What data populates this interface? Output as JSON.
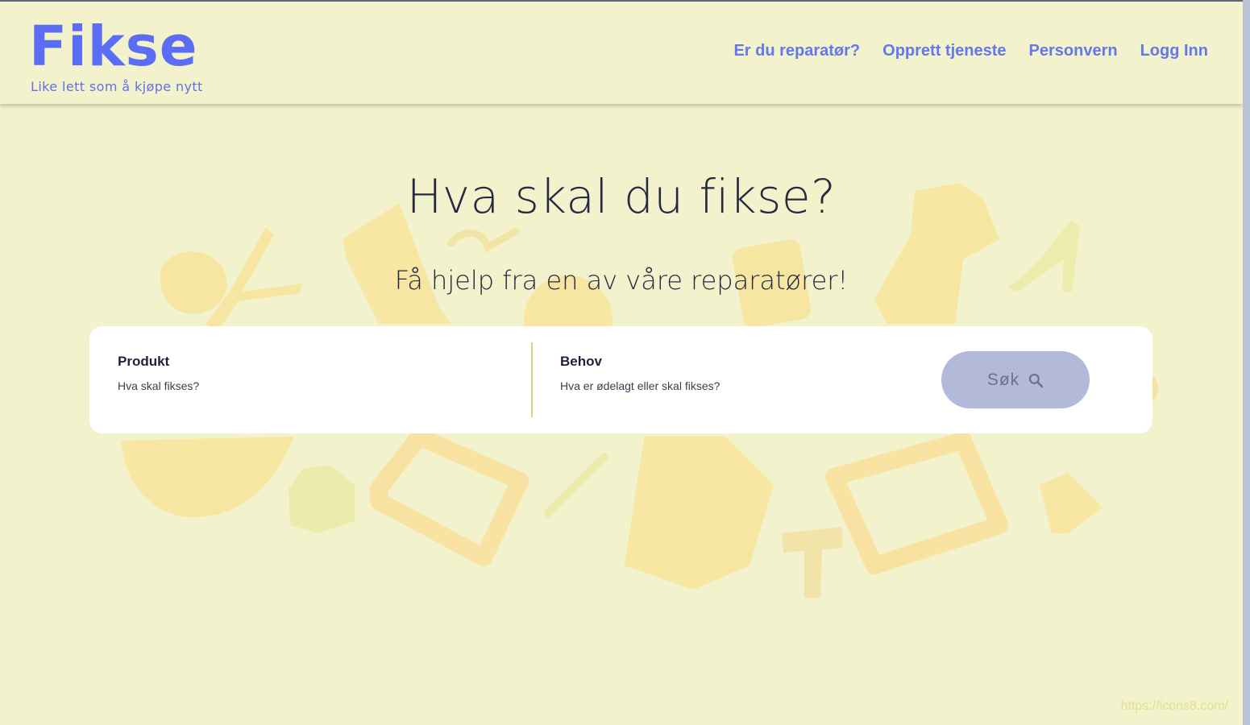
{
  "header": {
    "logo": "Fikse",
    "tagline": "Like lett som å kjøpe nytt",
    "nav": [
      "Er du reparatør?",
      "Opprett tjeneste",
      "Personvern",
      "Logg Inn"
    ]
  },
  "hero": {
    "title": "Hva skal du fikse?",
    "subtitle": "Få hjelp fra en av våre reparatører!"
  },
  "search": {
    "product_label": "Produkt",
    "product_placeholder": "Hva skal fikses?",
    "need_label": "Behov",
    "need_placeholder": "Hva er ødelagt eller skal fikses?",
    "button_label": "Søk",
    "button_icon": "search-icon"
  },
  "credit": "https://icons8.com/",
  "colors": {
    "background": "#f2f2cd",
    "brand": "#5b6df5",
    "nav": "#6477ee",
    "button": "#b3b9d8",
    "illustration": "#f9e8a2"
  }
}
